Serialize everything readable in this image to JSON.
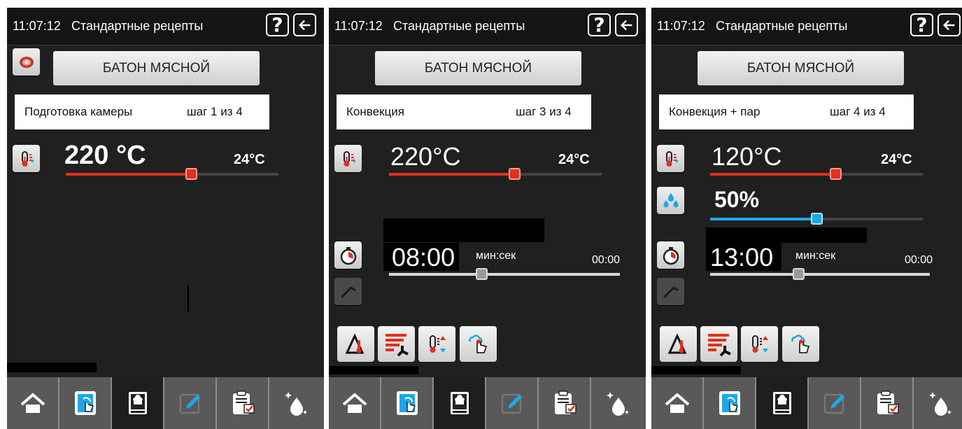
{
  "colors": {
    "temperature": "#e0301e",
    "humidity": "#1ea7e8",
    "time": "#d9d9d9",
    "panel": "#202020"
  },
  "panels": [
    {
      "time": "11:07:12",
      "title": "Стандартные рецепты",
      "recipe_name": "БАТОН МЯСНОЙ",
      "step_name": "Подготовка камеры",
      "step_counter": "шаг 1 из 4",
      "temperature": {
        "set": "220 °C",
        "current": "24°C",
        "level": 0.59
      }
    },
    {
      "time": "11:07:12",
      "title": "Стандартные рецепты",
      "recipe_name": "БАТОН МЯСНОЙ",
      "step_name": "Конвекция",
      "step_counter": "шаг 3 из 4",
      "temperature": {
        "set": "220°C",
        "current": "24°C",
        "level": 0.59
      },
      "timer": {
        "value": "08:00",
        "unit": "мин:сек",
        "end": "00:00",
        "level": 0.4
      }
    },
    {
      "time": "11:07:12",
      "title": "Стандартные рецепты",
      "recipe_name": "БАТОН МЯСНОЙ",
      "step_name": "Конвекция  + пар",
      "step_counter": "шаг 4 из 4",
      "temperature": {
        "set": "120°C",
        "current": "24°C",
        "level": 0.59
      },
      "humidity": {
        "value": "50%",
        "level": 0.5
      },
      "timer": {
        "value": "13:00",
        "unit": "мин:сек",
        "end": "00:00",
        "level": 0.4
      }
    }
  ],
  "icons": {
    "help": "?",
    "back": "arrow-left-icon",
    "recipe": "meat-icon",
    "temperature": "thermometer-icon",
    "humidity": "water-drops-icon",
    "timer": "stopwatch-icon",
    "probe": "core-probe-icon",
    "tools": [
      "delta-t-icon",
      "fan-heat-icon",
      "temp-adjust-icon",
      "touch-steam-icon"
    ],
    "nav": [
      "home-icon",
      "tablet-touch-icon",
      "recipe-book-icon",
      "edit-icon",
      "clipboard-icon",
      "wash-icon"
    ]
  }
}
